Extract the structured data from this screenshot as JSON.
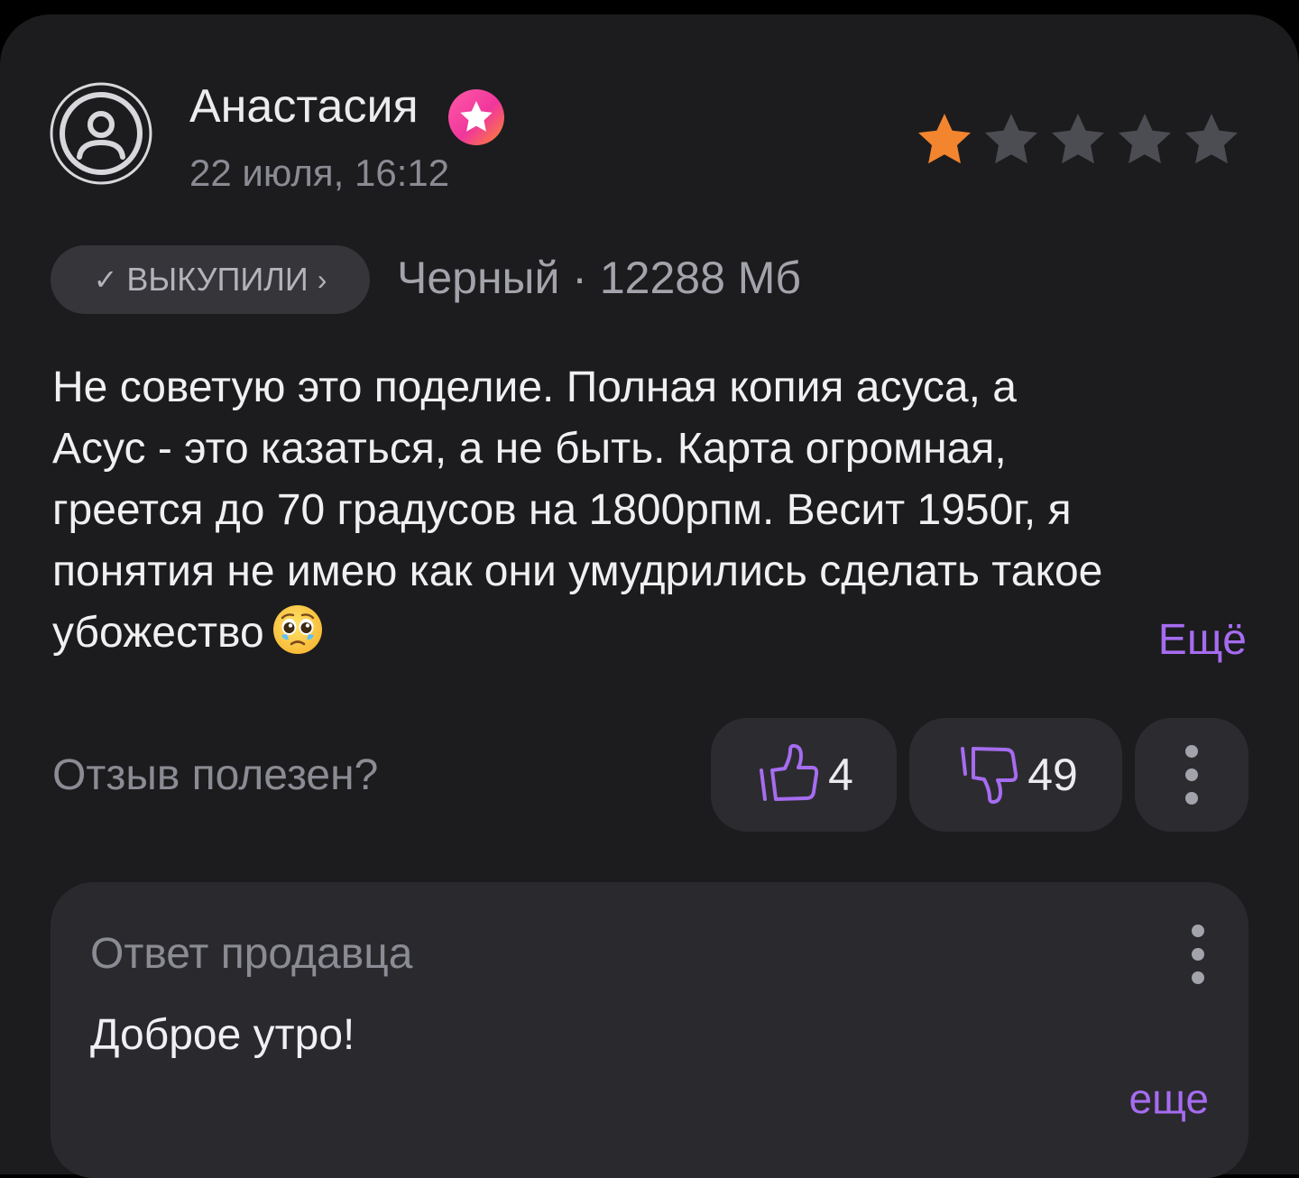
{
  "review": {
    "author_name": "Анастасия",
    "date": "22 июля, 16:12",
    "rating": 1,
    "max_rating": 5,
    "chip_check_icon": "✓",
    "chip_label": "ВЫКУПИЛИ",
    "chip_chevron_icon": "›",
    "variant": "Черный · 12288 Мб",
    "text_lines": [
      "Не советую это поделие. Полная копия асуса, а",
      "Асус - это казаться, а не быть. Карта огромная,",
      "греется до 70 градусов на 1800рпм. Весит 1950г, я",
      "понятия не имею как они умудрились сделать такое",
      "убожество"
    ],
    "more_label": "Ещё",
    "icons": {
      "avatar": "user-circle-icon",
      "badge": "star-badge-icon",
      "emoji": "pleading-face-icon"
    }
  },
  "votes": {
    "helpful_label": "Отзыв полезен?",
    "likes": "4",
    "dislikes": "49",
    "icons": {
      "like": "thumbs-up-icon",
      "dislike": "thumbs-down-icon",
      "menu": "more-vertical-icon"
    }
  },
  "seller_answer": {
    "title": "Ответ продавца",
    "text": "Доброе утро!",
    "more_label": "еще"
  },
  "colors": {
    "accent": "#a66cf0",
    "star_filled": "#f3852e",
    "star_empty": "#4c4c53",
    "card_bg": "#1c1c1e",
    "answer_bg": "#2a2a2e"
  }
}
